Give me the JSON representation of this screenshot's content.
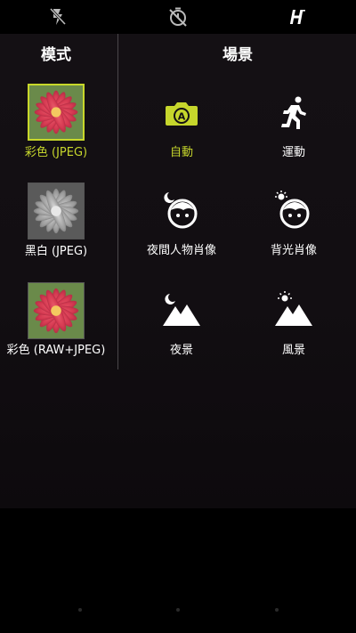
{
  "topbar": {
    "icons": [
      "flash-off-icon",
      "timer-off-icon",
      "hasselblad-logo-icon"
    ]
  },
  "modes": {
    "title": "模式",
    "items": [
      {
        "label": "彩色 (JPEG)",
        "selected": true
      },
      {
        "label": "黑白 (JPEG)",
        "selected": false
      },
      {
        "label": "彩色 (RAW+JPEG)",
        "selected": false
      }
    ]
  },
  "scenes": {
    "title": "場景",
    "items": [
      {
        "label": "自動",
        "icon": "auto-camera-icon",
        "selected": true
      },
      {
        "label": "運動",
        "icon": "running-person-icon",
        "selected": false
      },
      {
        "label": "夜間人物肖像",
        "icon": "night-portrait-icon",
        "selected": false
      },
      {
        "label": "背光肖像",
        "icon": "backlight-portrait-icon",
        "selected": false
      },
      {
        "label": "夜景",
        "icon": "night-landscape-icon",
        "selected": false
      },
      {
        "label": "風景",
        "icon": "landscape-icon",
        "selected": false
      }
    ]
  },
  "colors": {
    "accent": "#c6d62c",
    "background": "#000000",
    "panel": "#141014"
  }
}
